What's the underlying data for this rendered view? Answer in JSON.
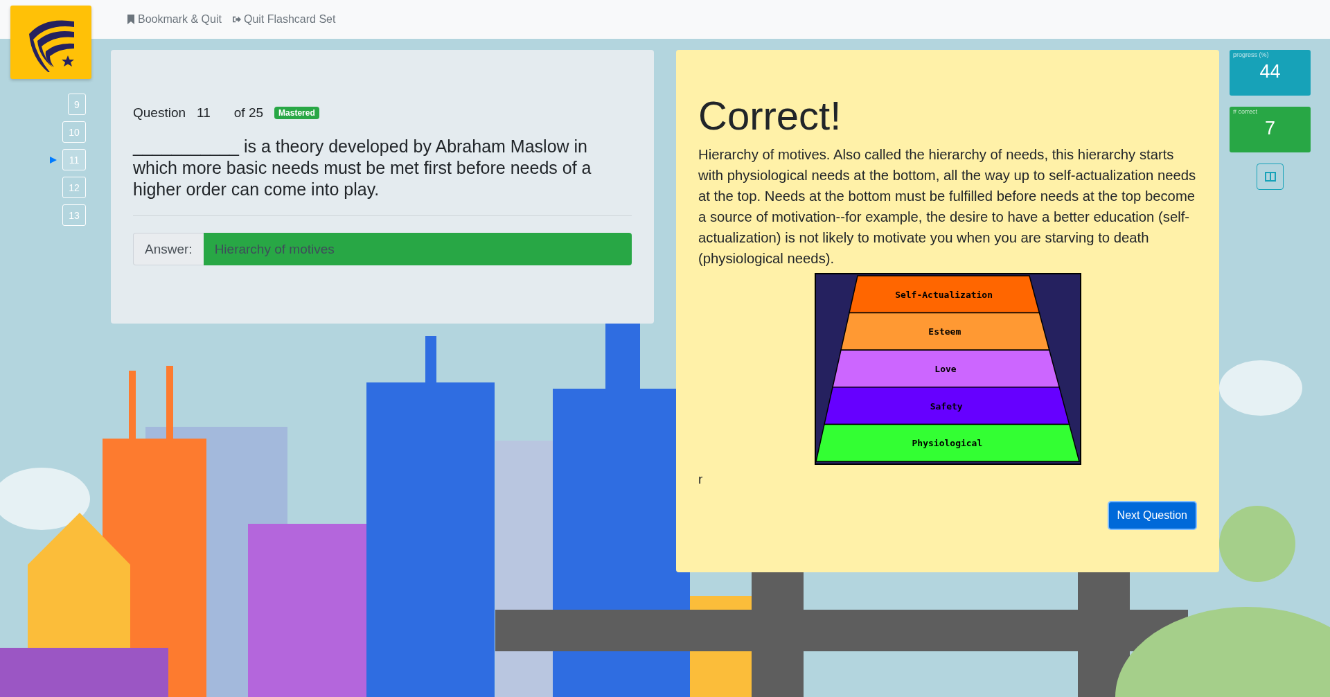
{
  "nav": [
    {
      "kind": "bookmark",
      "label": "Bookmark & Quit"
    },
    {
      "kind": "quit",
      "label": "Quit Flashcard Set"
    }
  ],
  "question_nav": [
    {
      "label": "9",
      "selected": false
    },
    {
      "label": "10",
      "selected": false
    },
    {
      "label": "11",
      "selected": true
    },
    {
      "label": "12",
      "selected": false
    },
    {
      "label": "13",
      "selected": false
    }
  ],
  "question": {
    "label": "Question",
    "number": "11",
    "total": "of 25",
    "badge": "Mastered",
    "text": "___________ is a theory developed by Abraham Maslow in which more basic needs must be met first before needs of a higher order can come into play.",
    "answer_label": "Answer:",
    "answer": "Hierarchy of motives",
    "correct": true
  },
  "feedback": {
    "title": "Correct!",
    "explanation": "Hierarchy of motives. Also called the hierarchy of needs, this hierarchy starts with physiological needs at the bottom, all the way up to self-actualization needs at the top. Needs at the bottom must be fulfilled before needs at the top become a source of motivation--for example, the desire to have a better education (self-actualization) is not likely to motivate you when you are starving to death (physiological needs).",
    "pyramid": [
      {
        "label": "Self-Actualization",
        "color": "#ff6600"
      },
      {
        "label": "Esteem",
        "color": "#ff9933"
      },
      {
        "label": "Love",
        "color": "#cc66ff"
      },
      {
        "label": "Safety",
        "color": "#6600ff"
      },
      {
        "label": "Physiological",
        "color": "#33ff33"
      }
    ],
    "note": "r",
    "button": "Next Question"
  },
  "stats": [
    {
      "label": "progress (%)",
      "value": "44",
      "color": "#17a2b8"
    },
    {
      "label": "# correct",
      "value": "7",
      "color": "#28a745"
    }
  ]
}
